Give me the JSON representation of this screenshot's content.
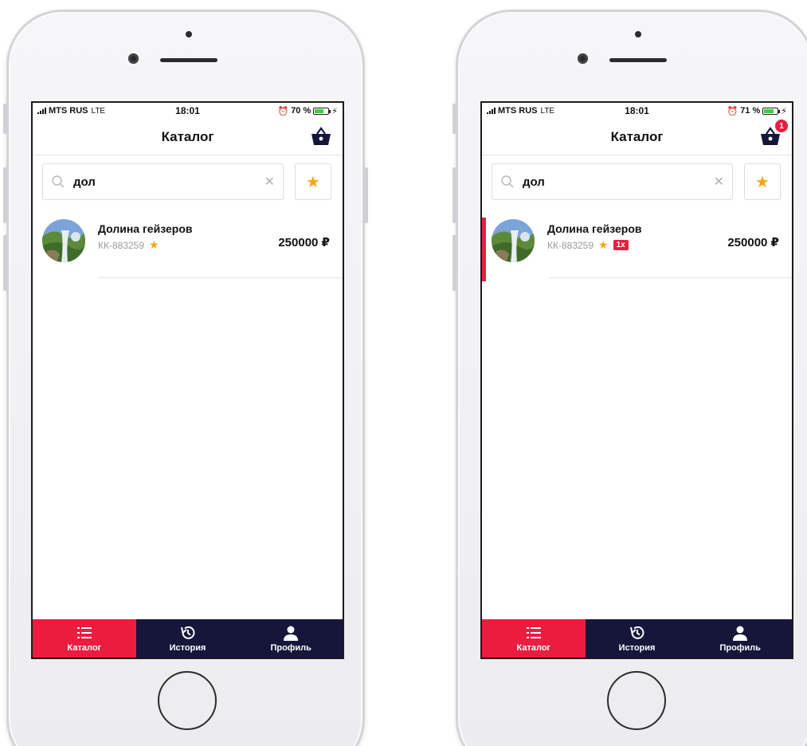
{
  "phones": [
    {
      "status": {
        "carrier": "MTS RUS",
        "network": "LTE",
        "time": "18:01",
        "battery": "70 %",
        "battery_level": 0.7
      },
      "header": {
        "title": "Каталог",
        "cart_count": ""
      },
      "search": {
        "query": "дол"
      },
      "item": {
        "name": "Долина гейзеров",
        "code": "КК-883259",
        "price": "250000 ₽",
        "quantity": "",
        "selected": false
      },
      "tabs": [
        {
          "label": "Каталог",
          "icon": "list-icon"
        },
        {
          "label": "История",
          "icon": "history-icon"
        },
        {
          "label": "Профиль",
          "icon": "person-icon"
        }
      ]
    },
    {
      "status": {
        "carrier": "MTS RUS",
        "network": "LTE",
        "time": "18:01",
        "battery": "71 %",
        "battery_level": 0.71
      },
      "header": {
        "title": "Каталог",
        "cart_count": "1"
      },
      "search": {
        "query": "дол"
      },
      "item": {
        "name": "Долина гейзеров",
        "code": "КК-883259",
        "price": "250000 ₽",
        "quantity": "1x",
        "selected": true
      },
      "tabs": [
        {
          "label": "Каталог",
          "icon": "list-icon"
        },
        {
          "label": "История",
          "icon": "history-icon"
        },
        {
          "label": "Профиль",
          "icon": "person-icon"
        }
      ]
    }
  ],
  "colors": {
    "accent": "#ea1d3f",
    "tabbar": "#15163a",
    "star": "#f3a51b",
    "battery": "#3fce3f"
  }
}
